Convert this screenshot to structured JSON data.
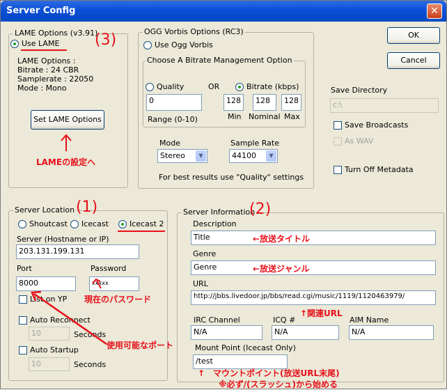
{
  "window": {
    "title": "Server Config",
    "close_glyph": "✕"
  },
  "buttons": {
    "ok": "OK",
    "cancel": "Cancel",
    "set_lame": "Set LAME Options"
  },
  "lame": {
    "legend": "LAME Options (v3.91)",
    "use_lame": "Use LAME",
    "info_header": "LAME Options :",
    "bitrate": "Bitrate : 24 CBR",
    "samplerate": "Samplerate : 22050",
    "mode": "Mode : Mono"
  },
  "ogg": {
    "legend": "OGG Vorbis Options (RC3)",
    "use_ogg": "Use Ogg Vorbis",
    "bitrate_group": "Choose A Bitrate Management Option",
    "quality": "Quality",
    "or": "OR",
    "bitrate_kbps": "Bitrate (kbps)",
    "quality_value": "0",
    "range": "Range (0-10)",
    "min_value": "128",
    "nominal_value": "128",
    "max_value": "128",
    "min": "Min",
    "nominal": "Nominal",
    "max": "Max",
    "mode_label": "Mode",
    "mode_value": "Stereo",
    "sample_rate_label": "Sample Rate",
    "sample_rate_value": "44100",
    "hint": "For best results use \"Quality\" settings"
  },
  "right": {
    "save_directory": "Save Directory",
    "save_directory_value": "c:\\",
    "save_broadcasts": "Save Broadcasts",
    "as_wav": "As WAV",
    "turn_off_metadata": "Turn Off Metadata"
  },
  "location": {
    "legend": "Server Location",
    "shoutcast": "Shoutcast",
    "icecast": "Icecast",
    "icecast2": "Icecast 2",
    "server_label": "Server (Hostname or IP)",
    "server_value": "203.131.199.131",
    "port_label": "Port",
    "port_value": "8000",
    "password_label": "Password",
    "password_value": "xxxxx",
    "list_on_yp": "List on YP",
    "auto_reconnect": "Auto Reconnect",
    "reconnect_value": "10",
    "auto_startup": "Auto Startup",
    "startup_value": "10",
    "seconds": "Seconds"
  },
  "info": {
    "legend": "Server Information",
    "description_label": "Description",
    "description_value": "Title",
    "genre_label": "Genre",
    "genre_value": "Genre",
    "url_label": "URL",
    "url_value": "http://jbbs.livedoor.jp/bbs/read.cgi/music/1119/1120463979/",
    "irc_label": "IRC Channel",
    "irc_value": "N/A",
    "icq_label": "ICQ #",
    "icq_value": "N/A",
    "aim_label": "AIM Name",
    "aim_value": "N/A",
    "mount_label": "Mount Point (Icecast Only)",
    "mount_value": "/test"
  },
  "annotations": {
    "n1": "(1)",
    "n2": "(2)",
    "n3": "(3)",
    "lame_settings": "LAMEの設定へ",
    "title_note": "←放送タイトル",
    "genre_note": "←放送ジャンル",
    "url_note": "↑関連URL",
    "password_note": "現在のパスワード",
    "port_note": "使用可能なポート",
    "mount_note": "↑　マウントポイント(放送URL末尾)",
    "mount_note2": "※必ず/(スラッシュ)から始める",
    "accent": "#e8101a"
  }
}
